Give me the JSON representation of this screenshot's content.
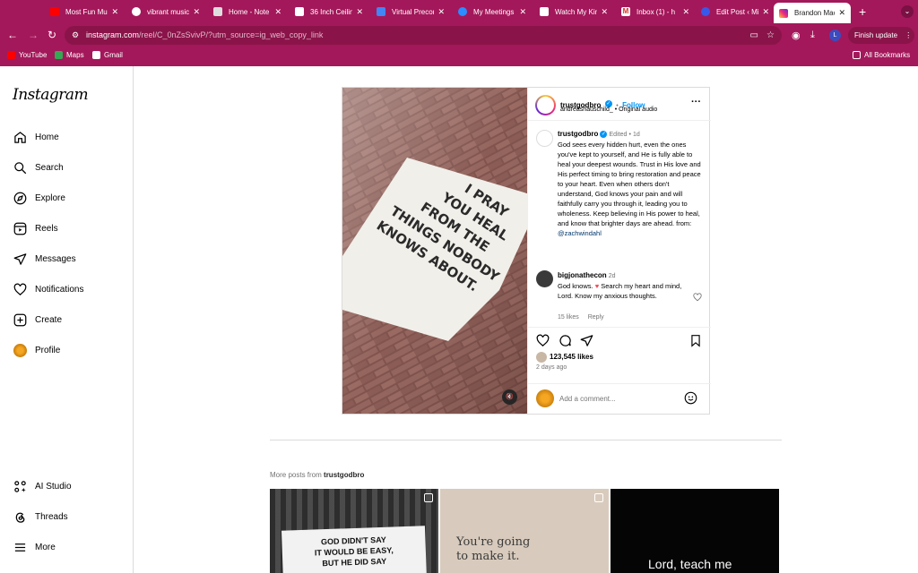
{
  "browser": {
    "tabs": [
      {
        "title": "Most Fun Mu"
      },
      {
        "title": "vibrant music"
      },
      {
        "title": "Home - Note"
      },
      {
        "title": "36 Inch Ceilin"
      },
      {
        "title": "Virtual Precon"
      },
      {
        "title": "My Meetings"
      },
      {
        "title": "Watch My Kin"
      },
      {
        "title": "Inbox (1) - h"
      },
      {
        "title": "Edit Post ‹ Mi"
      },
      {
        "title": "Brandon Mac"
      }
    ],
    "url_host": "instagram.com",
    "url_path": "/reel/C_0nZsSvivP/?utm_source=ig_web_copy_link",
    "profile_initial": "L",
    "finish_update": "Finish update",
    "bookmarks": [
      "YouTube",
      "Maps",
      "Gmail"
    ],
    "all_bookmarks": "All Bookmarks"
  },
  "sidebar": {
    "logo": "Instagram",
    "items": [
      "Home",
      "Search",
      "Explore",
      "Reels",
      "Messages",
      "Notifications",
      "Create",
      "Profile"
    ],
    "bottom": [
      "AI Studio",
      "Threads",
      "More"
    ]
  },
  "post": {
    "author": "trustgodbro",
    "follow": "Follow",
    "audio_user": "andreashauschild_",
    "audio_label": "Original audio",
    "edited": "Edited",
    "age": "1d",
    "caption": "God sees every hidden hurt, even the ones you've kept to yourself, and He is fully able to heal your deepest wounds. Trust in His love and His perfect timing to bring restoration and peace to your heart. Even when others don't understand, God knows your pain and will faithfully carry you through it, leading you to wholeness. Keep believing in His power to heal, and know that brighter days are ahead. from:",
    "caption_mention": "@zachwindahl",
    "image_text": [
      "I PRAY",
      "YOU HEAL",
      "FROM THE",
      "THINGS NOBODY",
      "KNOWS ABOUT."
    ],
    "comment": {
      "user": "bigjonathecon",
      "age": "2d",
      "text_before": "God knows.",
      "text_after": "Search my heart and mind, Lord. Know my anxious thoughts.",
      "likes": "15 likes",
      "reply": "Reply"
    },
    "likes": "123,545 likes",
    "date": "2 days ago",
    "add_comment_placeholder": "Add a comment..."
  },
  "more_posts": {
    "prefix": "More posts from",
    "user": "trustgodbro",
    "thumbs": [
      {
        "lines": [
          "GOD DIDN'T SAY",
          "IT WOULD BE EASY,",
          "BUT HE DID SAY"
        ]
      },
      {
        "lines": [
          "You're going",
          "to make it."
        ]
      },
      {
        "lines": [
          "Lord, teach me"
        ]
      }
    ]
  },
  "colors": {
    "chrome": "#a3185a",
    "link_blue": "#0095f6",
    "heart": "#ed4956"
  }
}
